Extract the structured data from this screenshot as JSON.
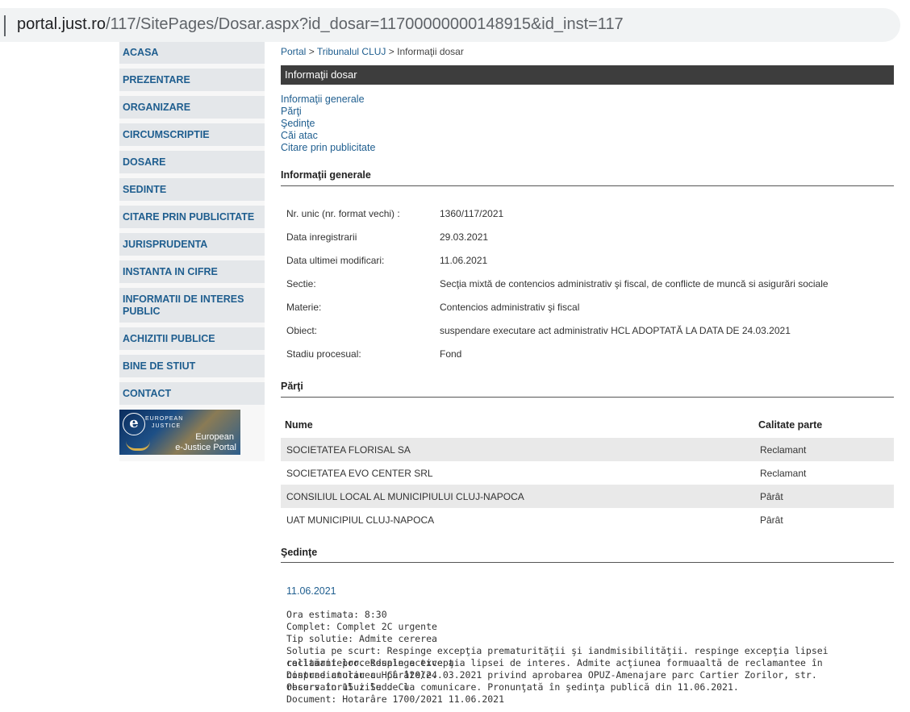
{
  "browser": {
    "url_host": "portal.just.ro",
    "url_path": "/117/SitePages/Dosar.aspx?id_dosar=11700000000148915&id_inst=117"
  },
  "sidebar": {
    "items": [
      {
        "label": "ACASA"
      },
      {
        "label": "PREZENTARE"
      },
      {
        "label": "ORGANIZARE"
      },
      {
        "label": "CIRCUMSCRIPTIE"
      },
      {
        "label": "DOSARE"
      },
      {
        "label": "SEDINTE"
      },
      {
        "label": "CITARE PRIN PUBLICITATE"
      },
      {
        "label": "JURISPRUDENTA"
      },
      {
        "label": "INSTANTA IN CIFRE"
      },
      {
        "label": "INFORMATII DE INTERES PUBLIC"
      },
      {
        "label": "ACHIZITII PUBLICE"
      },
      {
        "label": "BINE DE STIUT"
      },
      {
        "label": "CONTACT"
      }
    ],
    "banner": {
      "top_line1": "EUROPEAN",
      "top_line2": "JUSTICE",
      "line1": "European",
      "line2": "e-Justice Portal"
    }
  },
  "breadcrumb": {
    "portal": "Portal",
    "sep": ">",
    "court": "Tribunalul CLUJ",
    "current": "Informaţii dosar"
  },
  "page_title": "Informaţii dosar",
  "anchors": [
    "Informaţii generale",
    "Părţi",
    "Şedinţe",
    "Căi atac",
    "Citare prin publicitate"
  ],
  "general": {
    "heading": "Informaţii generale",
    "rows": [
      {
        "label": "Nr. unic (nr. format vechi) :",
        "value": "1360/117/2021"
      },
      {
        "label": "Data inregistrarii",
        "value": "29.03.2021"
      },
      {
        "label": "Data ultimei modificari:",
        "value": "11.06.2021"
      },
      {
        "label": "Sectie:",
        "value": "Secţia mixtă de contencios administrativ şi fiscal, de conflicte de muncă si asigurări sociale"
      },
      {
        "label": "Materie:",
        "value": "Contencios administrativ şi fiscal"
      },
      {
        "label": "Obiect:",
        "value": "suspendare executare act administrativ HCL ADOPTATĂ LA DATA DE 24.03.2021"
      },
      {
        "label": "Stadiu procesual:",
        "value": "Fond"
      }
    ]
  },
  "parties": {
    "heading": "Părţi",
    "col_name": "Nume",
    "col_role": "Calitate parte",
    "rows": [
      {
        "name": "SOCIETATEA FLORISAL SA",
        "role": "Reclamant"
      },
      {
        "name": "SOCIETATEA EVO CENTER SRL",
        "role": "Reclamant"
      },
      {
        "name": "CONSILIUL LOCAL AL MUNICIPIULUI CLUJ-NAPOCA",
        "role": "Pârât"
      },
      {
        "name": "UAT MUNICIPIUL CLUJ-NAPOCA",
        "role": "Pârât"
      }
    ]
  },
  "hearings": {
    "heading": "Şedinţe",
    "date": "11.06.2021",
    "lines": [
      "Ora estimata: 8:30",
      "Complet: Complet 2C urgente",
      "Tip solutie: Admite cererea",
      "Solutia pe scurt: Respinge excepţia prematurităţii şi iandmisibilităţii. respinge excepţia lipsei calitării procesduale active a",
      "reclamantelor. Respinge excepţia lipsei de interes. Admite acţiunea formuaaltă de reclamantee în contradictoriu cu pârâtele.",
      "Dispune anularea HCL 120/24.03.2021 privind aprobarea OPUZ-Amenajare parc Cartier Zorilor, str. Observatorului Sud. Cu",
      "recurs în 15 zile de la comunicare. Pronunţată în şedinţa publică din 11.06.2021.",
      "Document: Hotarâre  1700/2021  11.06.2021"
    ]
  }
}
